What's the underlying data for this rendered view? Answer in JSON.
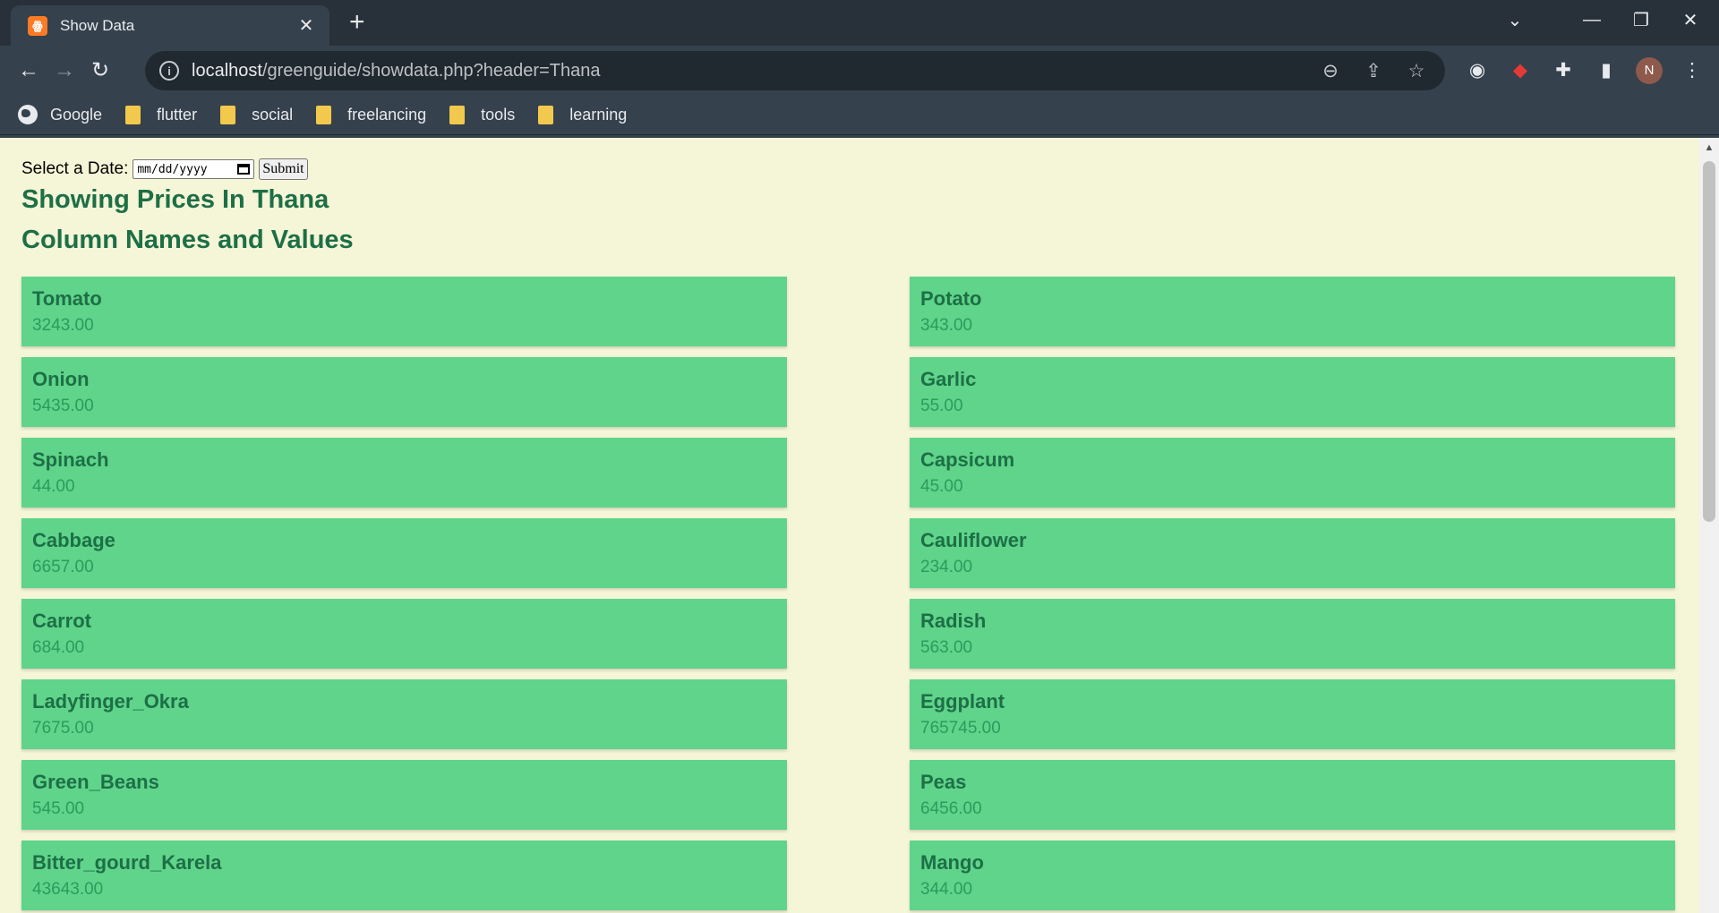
{
  "browser": {
    "tab_title": "Show Data",
    "tab_favicon": "xampp-icon",
    "url_host": "localhost",
    "url_path": "/greenguide/showdata.php?header=Thana",
    "bookmarks": [
      "Google",
      "flutter",
      "social",
      "freelancing",
      "tools",
      "learning"
    ],
    "profile_initial": "N"
  },
  "form": {
    "label": "Select a Date:",
    "date_placeholder": "mm/dd/yyyy",
    "submit_label": "Submit"
  },
  "heading": "Showing Prices In Thana",
  "subheading": "Column Names and Values",
  "items": [
    {
      "name": "Tomato",
      "value": "3243.00"
    },
    {
      "name": "Potato",
      "value": "343.00"
    },
    {
      "name": "Onion",
      "value": "5435.00"
    },
    {
      "name": "Garlic",
      "value": "55.00"
    },
    {
      "name": "Spinach",
      "value": "44.00"
    },
    {
      "name": "Capsicum",
      "value": "45.00"
    },
    {
      "name": "Cabbage",
      "value": "6657.00"
    },
    {
      "name": "Cauliflower",
      "value": "234.00"
    },
    {
      "name": "Carrot",
      "value": "684.00"
    },
    {
      "name": "Radish",
      "value": "563.00"
    },
    {
      "name": "Ladyfinger_Okra",
      "value": "7675.00"
    },
    {
      "name": "Eggplant",
      "value": "765745.00"
    },
    {
      "name": "Green_Beans",
      "value": "545.00"
    },
    {
      "name": "Peas",
      "value": "6456.00"
    },
    {
      "name": "Bitter_gourd_Karela",
      "value": "43643.00"
    },
    {
      "name": "Mango",
      "value": "344.00"
    }
  ],
  "colors": {
    "page_bg": "#f5f5d7",
    "card_bg": "#5fd48a",
    "heading": "#1d6f46",
    "chrome_bg": "#35414d"
  }
}
